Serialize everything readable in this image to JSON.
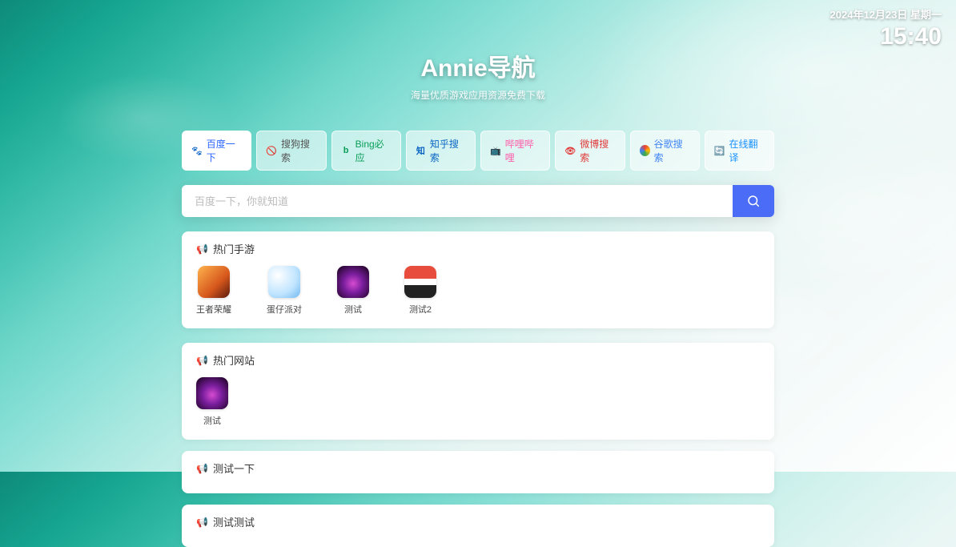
{
  "datetime": {
    "date": "2024年12月23日 星期一",
    "time": "15:40"
  },
  "hero": {
    "title": "Annie导航",
    "subtitle": "海量优质游戏应用资源免费下载"
  },
  "engines": [
    {
      "label": "百度一下",
      "cls": "lbl-blue",
      "ico": "baidu-ico",
      "glyph": "🐾",
      "active": true
    },
    {
      "label": "搜狗搜索",
      "cls": "lbl-gray",
      "ico": "sogou-ico",
      "glyph": "🚫",
      "active": false
    },
    {
      "label": "Bing必应",
      "cls": "lbl-green",
      "ico": "bing-ico",
      "glyph": "b",
      "active": false
    },
    {
      "label": "知乎搜索",
      "cls": "lbl-zhihu",
      "ico": "zhihu-ico",
      "glyph": "知",
      "active": false
    },
    {
      "label": "哔哩哔哩",
      "cls": "lbl-pink",
      "ico": "bili-ico",
      "glyph": "📺",
      "active": false
    },
    {
      "label": "微博搜索",
      "cls": "lbl-red",
      "ico": "weibo-ico",
      "glyph": "👁",
      "active": false
    },
    {
      "label": "谷歌搜索",
      "cls": "lbl-google",
      "ico": "google-ico",
      "glyph": "",
      "active": false
    },
    {
      "label": "在线翻译",
      "cls": "lbl-trans",
      "ico": "trans-ico",
      "glyph": "🔄",
      "active": false
    }
  ],
  "search": {
    "placeholder": "百度一下，你就知道"
  },
  "sections": [
    {
      "title": "热门手游",
      "apps": [
        {
          "label": "王者荣耀",
          "icon": "icon-wzry"
        },
        {
          "label": "蛋仔派对",
          "icon": "icon-dzpd"
        },
        {
          "label": "测试",
          "icon": "icon-cs"
        },
        {
          "label": "测试2",
          "icon": "icon-cs2"
        }
      ]
    },
    {
      "title": "热门网站",
      "apps": [
        {
          "label": "测试",
          "icon": "icon-cs"
        }
      ]
    },
    {
      "title": "测试一下",
      "apps": []
    },
    {
      "title": "测试测试",
      "apps": []
    }
  ]
}
